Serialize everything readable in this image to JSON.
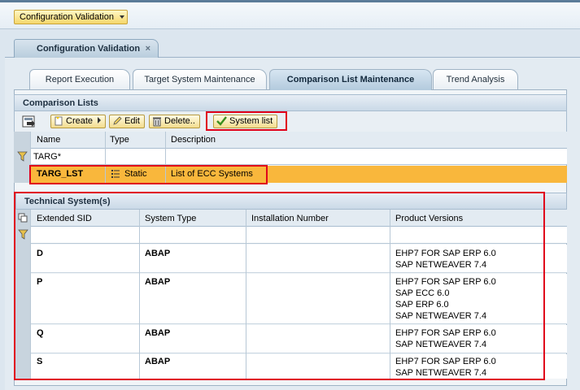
{
  "app_menu": {
    "label": "Configuration Validation"
  },
  "main_tab": {
    "label": "Configuration Validation",
    "close": "×"
  },
  "sub_tabs": [
    {
      "label": "Report Execution"
    },
    {
      "label": "Target System Maintenance"
    },
    {
      "label": "Comparison List Maintenance",
      "active": true
    },
    {
      "label": "Trend Analysis"
    }
  ],
  "comparison_lists": {
    "title": "Comparison Lists",
    "toolbar": {
      "create": "Create",
      "edit": "Edit",
      "delete": "Delete..",
      "system_list": "System list"
    },
    "columns": [
      "Name",
      "Type",
      "Description"
    ],
    "filter_value": "TARG*",
    "rows": [
      {
        "name": "TARG_LST",
        "type": "Static",
        "description": "List of ECC Systems"
      }
    ]
  },
  "technical_systems": {
    "title": "Technical System(s)",
    "columns": [
      "Extended SID",
      "System Type",
      "Installation Number",
      "Product Versions"
    ],
    "rows": [
      {
        "sid": "D",
        "type": "ABAP",
        "installation": "",
        "products": [
          "EHP7 FOR SAP ERP 6.0",
          "SAP NETWEAVER 7.4"
        ]
      },
      {
        "sid": "P",
        "type": "ABAP",
        "installation": "",
        "products": [
          "EHP7 FOR SAP ERP 6.0",
          "SAP ECC 6.0",
          "SAP ERP 6.0",
          "SAP NETWEAVER 7.4"
        ]
      },
      {
        "sid": "Q",
        "type": "ABAP",
        "installation": "",
        "products": [
          "EHP7 FOR SAP ERP 6.0",
          "SAP NETWEAVER 7.4"
        ]
      },
      {
        "sid": "S",
        "type": "ABAP",
        "installation": "",
        "products": [
          "EHP7 FOR SAP ERP 6.0",
          "SAP NETWEAVER 7.4"
        ]
      }
    ]
  },
  "colors": {
    "highlight": "#f9b73c",
    "annotation_red": "#e0001b",
    "button_gold": "#f3dc8e"
  }
}
